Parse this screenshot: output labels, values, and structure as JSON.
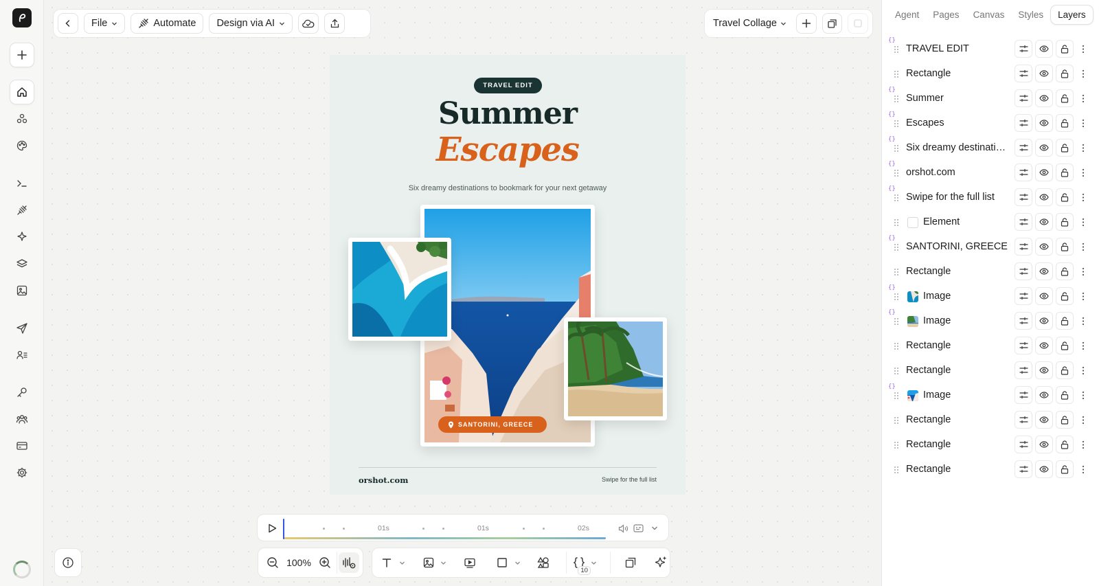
{
  "toolbar": {
    "file_label": "File",
    "automate_label": "Automate",
    "design_ai_label": "Design via AI",
    "project_name": "Travel Collage"
  },
  "artboard": {
    "badge": "TRAVEL EDIT",
    "title_line1": "Summer",
    "title_line2": "Escapes",
    "subtitle": "Six dreamy destinations to bookmark for your next getaway",
    "location": "SANTORINI, GREECE",
    "site": "orshot.com",
    "swipe": "Swipe for the full list",
    "accent_color": "#d8621c",
    "dark_color": "#172a28"
  },
  "timeline": {
    "labels": [
      "01s",
      "01s",
      "02s"
    ]
  },
  "bottom": {
    "zoom": "100%",
    "variables_count": "10"
  },
  "panel": {
    "tabs": [
      "Agent",
      "Pages",
      "Canvas",
      "Styles",
      "Layers"
    ],
    "active_tab": "Layers",
    "layers": [
      {
        "name": "TRAVEL EDIT",
        "var": true,
        "thumb": ""
      },
      {
        "name": "Rectangle",
        "var": false,
        "thumb": ""
      },
      {
        "name": "Summer",
        "var": true,
        "thumb": ""
      },
      {
        "name": "Escapes",
        "var": true,
        "thumb": ""
      },
      {
        "name": "Six dreamy destinations to bookmark for your next getaway",
        "var": true,
        "thumb": ""
      },
      {
        "name": "orshot.com",
        "var": true,
        "thumb": ""
      },
      {
        "name": "Swipe for the full list",
        "var": true,
        "thumb": ""
      },
      {
        "name": "Element",
        "var": false,
        "thumb": "blank"
      },
      {
        "name": "SANTORINI, GREECE",
        "var": true,
        "thumb": ""
      },
      {
        "name": "Rectangle",
        "var": false,
        "thumb": ""
      },
      {
        "name": "Image",
        "var": true,
        "thumb": "sea"
      },
      {
        "name": "Image",
        "var": true,
        "thumb": "beach"
      },
      {
        "name": "Rectangle",
        "var": false,
        "thumb": ""
      },
      {
        "name": "Rectangle",
        "var": false,
        "thumb": ""
      },
      {
        "name": "Image",
        "var": true,
        "thumb": "santorini"
      },
      {
        "name": "Rectangle",
        "var": false,
        "thumb": ""
      },
      {
        "name": "Rectangle",
        "var": false,
        "thumb": ""
      },
      {
        "name": "Rectangle",
        "var": false,
        "thumb": ""
      }
    ]
  }
}
